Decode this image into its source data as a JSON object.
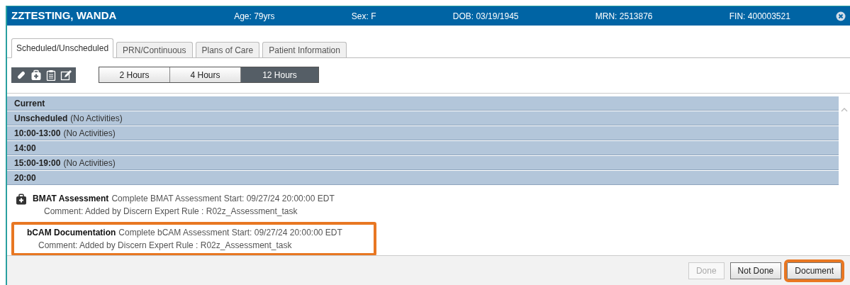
{
  "header": {
    "name": "ZZTESTING, WANDA",
    "fields": [
      "Age: 79yrs",
      "Sex: F",
      "DOB: 03/19/1945",
      "MRN: 2513876",
      "FIN: 400003521"
    ]
  },
  "tabs": [
    {
      "label": "Scheduled/Unscheduled",
      "selected": true
    },
    {
      "label": "PRN/Continuous",
      "selected": false
    },
    {
      "label": "Plans of Care",
      "selected": false
    },
    {
      "label": "Patient Information",
      "selected": false
    }
  ],
  "toolbar_icons": [
    {
      "kind": "pill"
    },
    {
      "kind": "medical-bag"
    },
    {
      "kind": "clipboard"
    },
    {
      "kind": "edit"
    }
  ],
  "ranges": [
    {
      "label": "2 Hours",
      "selected": false
    },
    {
      "label": "4 Hours",
      "selected": false
    },
    {
      "label": "12 Hours",
      "selected": true
    }
  ],
  "groups": [
    {
      "title": "Current"
    },
    {
      "title": "Unscheduled",
      "note": "(No Activities)"
    },
    {
      "title": "10:00-13:00",
      "note": "(No Activities)"
    },
    {
      "title": "14:00"
    },
    {
      "title": "15:00-19:00",
      "note": "(No Activities)"
    },
    {
      "title": "20:00"
    }
  ],
  "tasks": [
    {
      "name": "BMAT Assessment",
      "detail": "Complete BMAT Assessment Start: 09/27/24 20:00:00 EDT",
      "comment": "Comment: Added by Discern Expert Rule : R02z_Assessment_task",
      "has_icon": true,
      "highlighted": false
    },
    {
      "name": "bCAM Documentation",
      "detail": "Complete bCAM Assessment Start: 09/27/24 20:00:00 EDT",
      "comment": "Comment: Added by Discern Expert Rule : R02z_Assessment_task",
      "has_icon": false,
      "highlighted": true
    }
  ],
  "buttons": [
    {
      "label": "Done",
      "disabled": true,
      "highlighted": false
    },
    {
      "label": "Not Done",
      "disabled": false,
      "highlighted": false
    },
    {
      "label": "Document",
      "disabled": false,
      "highlighted": true
    }
  ]
}
